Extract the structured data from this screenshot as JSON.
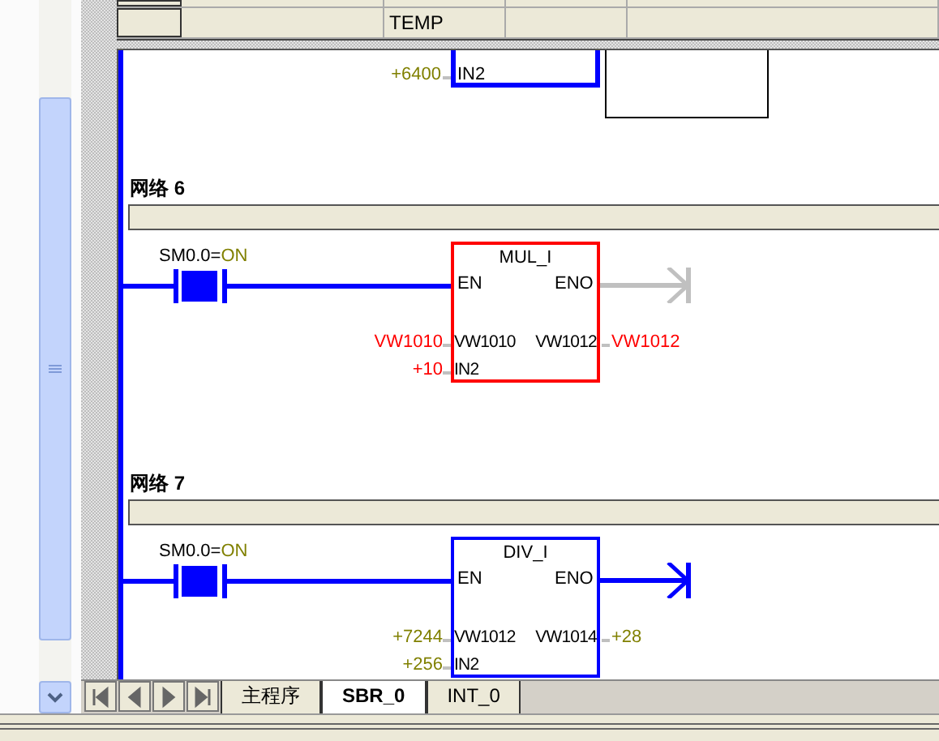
{
  "variable_table": {
    "rows": [
      {
        "type": "TEMP"
      }
    ]
  },
  "partial_network": {
    "inputs": [
      {
        "value": "+6400",
        "pin": "IN2"
      }
    ]
  },
  "networks": [
    {
      "title": "网络 6",
      "contact": {
        "address": "SM0.0=",
        "state": "ON",
        "closed": true
      },
      "box": {
        "name": "MUL_I",
        "error": true,
        "en": "EN",
        "eno": "ENO",
        "eno_powered": false,
        "inputs": [
          {
            "value": "VW1010",
            "pin": "VW1010"
          },
          {
            "value": "+10",
            "pin": "IN2"
          }
        ],
        "output": {
          "pin": "VW1012",
          "value": "VW1012"
        }
      }
    },
    {
      "title": "网络 7",
      "contact": {
        "address": "SM0.0=",
        "state": "ON",
        "closed": true
      },
      "box": {
        "name": "DIV_I",
        "error": false,
        "en": "EN",
        "eno": "ENO",
        "eno_powered": true,
        "inputs": [
          {
            "value": "+7244",
            "pin": "VW1012"
          },
          {
            "value": "+256",
            "pin": "IN2"
          }
        ],
        "output": {
          "pin": "VW1014",
          "value": "+28"
        }
      }
    }
  ],
  "tabs": [
    {
      "label": "主程序",
      "selected": false
    },
    {
      "label": "SBR_0",
      "selected": true
    },
    {
      "label": "INT_0",
      "selected": false
    }
  ]
}
